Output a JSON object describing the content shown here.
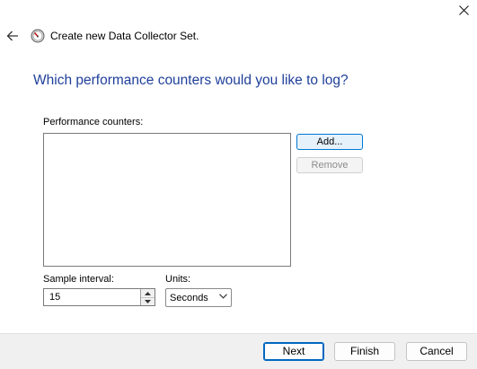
{
  "window": {
    "title": "Create new Data Collector Set.",
    "icons": {
      "back": "back-arrow-icon",
      "app": "performance-monitor-icon",
      "close": "close-icon"
    }
  },
  "page": {
    "heading": "Which performance counters would you like to log?",
    "counters_label": "Performance counters:",
    "counters": [],
    "add_label": "Add...",
    "remove_label": "Remove",
    "sample_interval_label": "Sample interval:",
    "sample_interval_value": "15",
    "units_label": "Units:",
    "units_value": "Seconds"
  },
  "footer": {
    "next_label": "Next",
    "finish_label": "Finish",
    "cancel_label": "Cancel"
  },
  "colors": {
    "heading": "#1f3f9a",
    "accent": "#0078d4",
    "footer_bg": "#f0f0f0"
  }
}
